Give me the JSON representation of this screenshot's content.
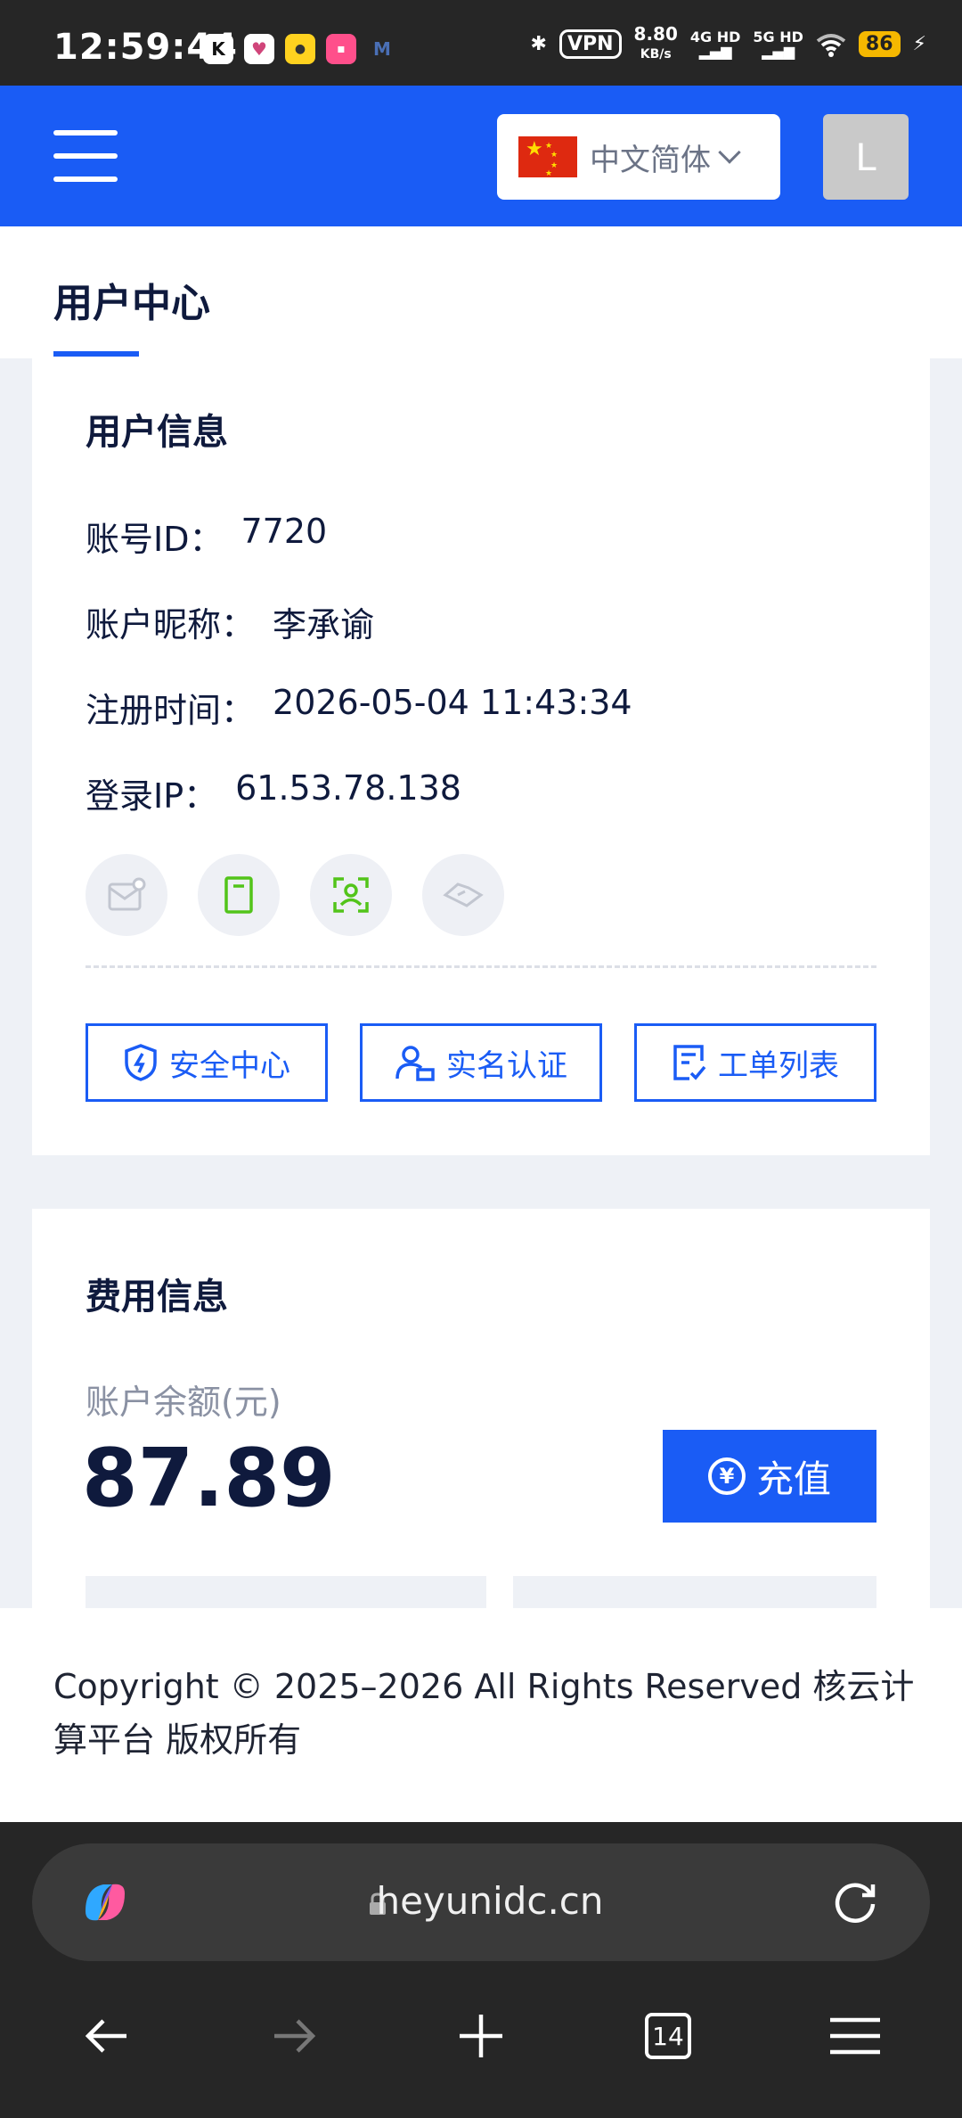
{
  "status_bar": {
    "time": "12:59:44",
    "vpn": "VPN",
    "speed_value": "8.80",
    "speed_unit": "KB/s",
    "net1": "4G HD",
    "net2": "5G HD",
    "battery": "86"
  },
  "header": {
    "language": "中文简体",
    "avatar_letter": "L",
    "colors": {
      "brand": "#1a5cf5",
      "avatar_bg": "#c9c9c9"
    }
  },
  "page": {
    "title": "用户中心"
  },
  "user_info": {
    "title": "用户信息",
    "rows": [
      {
        "label": "账号ID：",
        "value": "7720"
      },
      {
        "label": "账户昵称：",
        "value": "李承谕"
      },
      {
        "label": "注册时间：",
        "value": "2026-05-04 11:43:34"
      },
      {
        "label": "登录IP：",
        "value": "61.53.78.138"
      }
    ],
    "status_icons": [
      "email-verify-icon",
      "phone-verify-icon",
      "face-verify-icon",
      "wechat-bind-icon"
    ],
    "actions": [
      {
        "label": "安全中心",
        "icon": "shield-icon"
      },
      {
        "label": "实名认证",
        "icon": "user-id-icon"
      },
      {
        "label": "工单列表",
        "icon": "ticket-list-icon"
      }
    ]
  },
  "billing": {
    "title": "费用信息",
    "balance_label": "账户余额(元)",
    "balance_value": "87.89",
    "recharge_label": "充值"
  },
  "footer": {
    "copyright": "Copyright © 2025–2026 All Rights Reserved 核云计算平台 版权所有"
  },
  "browser": {
    "url": "heyunidc.cn",
    "tab_count": "14"
  }
}
